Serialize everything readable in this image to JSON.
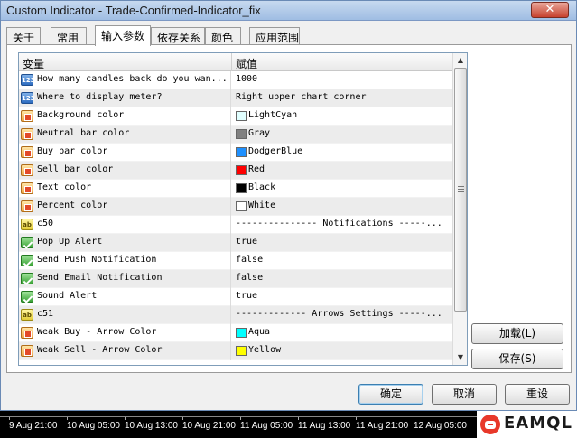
{
  "window": {
    "title": "Custom Indicator - Trade-Confirmed-Indicator_fix",
    "close_symbol": "✕"
  },
  "tabs": [
    {
      "label": "关于"
    },
    {
      "label": "常用"
    },
    {
      "label": "输入参数"
    },
    {
      "label": "依存关系"
    },
    {
      "label": "颜色"
    },
    {
      "label": "应用范围"
    }
  ],
  "grid": {
    "col_variable": "变量",
    "col_value": "赋值",
    "rows": [
      {
        "name": "How many candles back do you wan...",
        "value": "1000",
        "type": "int"
      },
      {
        "name": "Where to display meter?",
        "value": "Right upper chart corner",
        "type": "int"
      },
      {
        "name": "Background color",
        "value": "LightCyan",
        "type": "color",
        "swatch": "#e0ffff"
      },
      {
        "name": "Neutral bar color",
        "value": "Gray",
        "type": "color",
        "swatch": "#808080"
      },
      {
        "name": "Buy bar color",
        "value": "DodgerBlue",
        "type": "color",
        "swatch": "#1e90ff"
      },
      {
        "name": "Sell bar color",
        "value": "Red",
        "type": "color",
        "swatch": "#ff0000"
      },
      {
        "name": "Text color",
        "value": "Black",
        "type": "color",
        "swatch": "#000000"
      },
      {
        "name": "Percent color",
        "value": "White",
        "type": "color",
        "swatch": "#ffffff"
      },
      {
        "name": "c50",
        "value": "--------------- Notifications -----...",
        "type": "str"
      },
      {
        "name": "Pop Up Alert",
        "value": "true",
        "type": "bool"
      },
      {
        "name": "Send Push Notification",
        "value": "false",
        "type": "bool"
      },
      {
        "name": "Send Email Notification",
        "value": "false",
        "type": "bool"
      },
      {
        "name": "Sound Alert",
        "value": "true",
        "type": "bool"
      },
      {
        "name": "c51",
        "value": "------------- Arrows Settings -----...",
        "type": "str"
      },
      {
        "name": "Weak Buy - Arrow Color",
        "value": "Aqua",
        "type": "color",
        "swatch": "#00ffff"
      },
      {
        "name": "Weak Sell - Arrow Color",
        "value": "Yellow",
        "type": "color",
        "swatch": "#ffff00"
      }
    ]
  },
  "side_buttons": {
    "load": "加载(L)",
    "save": "保存(S)"
  },
  "bottom_buttons": {
    "ok": "确定",
    "cancel": "取消",
    "reset": "重设"
  },
  "time_axis": [
    "9 Aug 21:00",
    "10 Aug 05:00",
    "10 Aug 13:00",
    "10 Aug 21:00",
    "11 Aug 05:00",
    "11 Aug 13:00",
    "11 Aug 21:00",
    "12 Aug 05:00"
  ],
  "logo": {
    "text": "EAMQL"
  },
  "icons": {
    "int": "int-icon",
    "color": "color-icon",
    "str": "string-icon",
    "bool": "bool-icon"
  }
}
